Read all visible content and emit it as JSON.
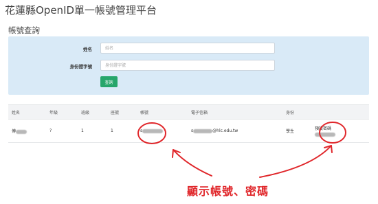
{
  "header": {
    "title": "花蓮縣OpenID單一帳號管理平台"
  },
  "search": {
    "section_title": "帳號查詢",
    "name_label": "姓名",
    "name_placeholder": "姓名",
    "id_label": "身份證字號",
    "id_placeholder": "身份證字號",
    "submit_label": "查詢"
  },
  "table": {
    "columns": [
      "姓名",
      "年級",
      "班級",
      "座號",
      "帳號",
      "電子信箱",
      "身份",
      ""
    ],
    "rows": [
      {
        "name_visible": "傅",
        "grade": "?",
        "class": "1",
        "seat": "1",
        "account_visible": "s",
        "email_visible_prefix": "s",
        "email_domain": "@hlc.edu.tw",
        "role": "學生",
        "password_label": "預設密碼"
      }
    ]
  },
  "annotation": {
    "text": "顯示帳號、密碼",
    "color": "#e0262a"
  },
  "colors": {
    "panel_bg": "#d9eaf7",
    "button_green": "#26a66b",
    "annotation_red": "#e0262a"
  }
}
